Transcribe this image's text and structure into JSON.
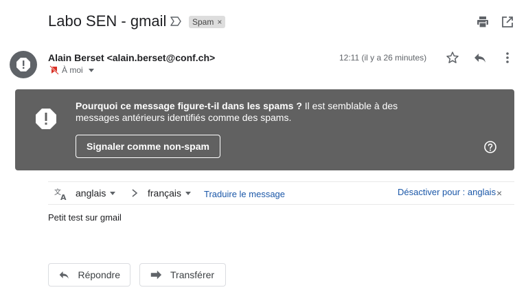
{
  "header": {
    "subject": "Labo SEN - gmail",
    "label_chip": "Spam",
    "label_chip_close": "×",
    "icons": [
      "label-important-icon",
      "print-icon",
      "open-in-new-window-icon"
    ]
  },
  "message": {
    "sender": "Alain Berset <alain.berset@conf.ch>",
    "recipient": "À moi",
    "time": "12:11 (il y a 26 minutes)",
    "icons": [
      "star-icon",
      "reply-icon",
      "more-vert-icon"
    ]
  },
  "spam_banner": {
    "question": "Pourquoi ce message figure-t-il dans les spams ?",
    "explanation": " Il est semblable à des messages antérieurs identifiés comme des spams.",
    "not_spam_label": "Signaler comme non-spam",
    "background": "#616161"
  },
  "translate": {
    "from_lang": "anglais",
    "to_lang": "français",
    "translate_label": "Traduire le message",
    "disable_label": "Désactiver pour : anglais",
    "close": "×",
    "link_color": "#1a57a8"
  },
  "body": {
    "text": "Petit test sur gmail"
  },
  "actions": {
    "reply_label": "Répondre",
    "forward_label": "Transférer"
  }
}
